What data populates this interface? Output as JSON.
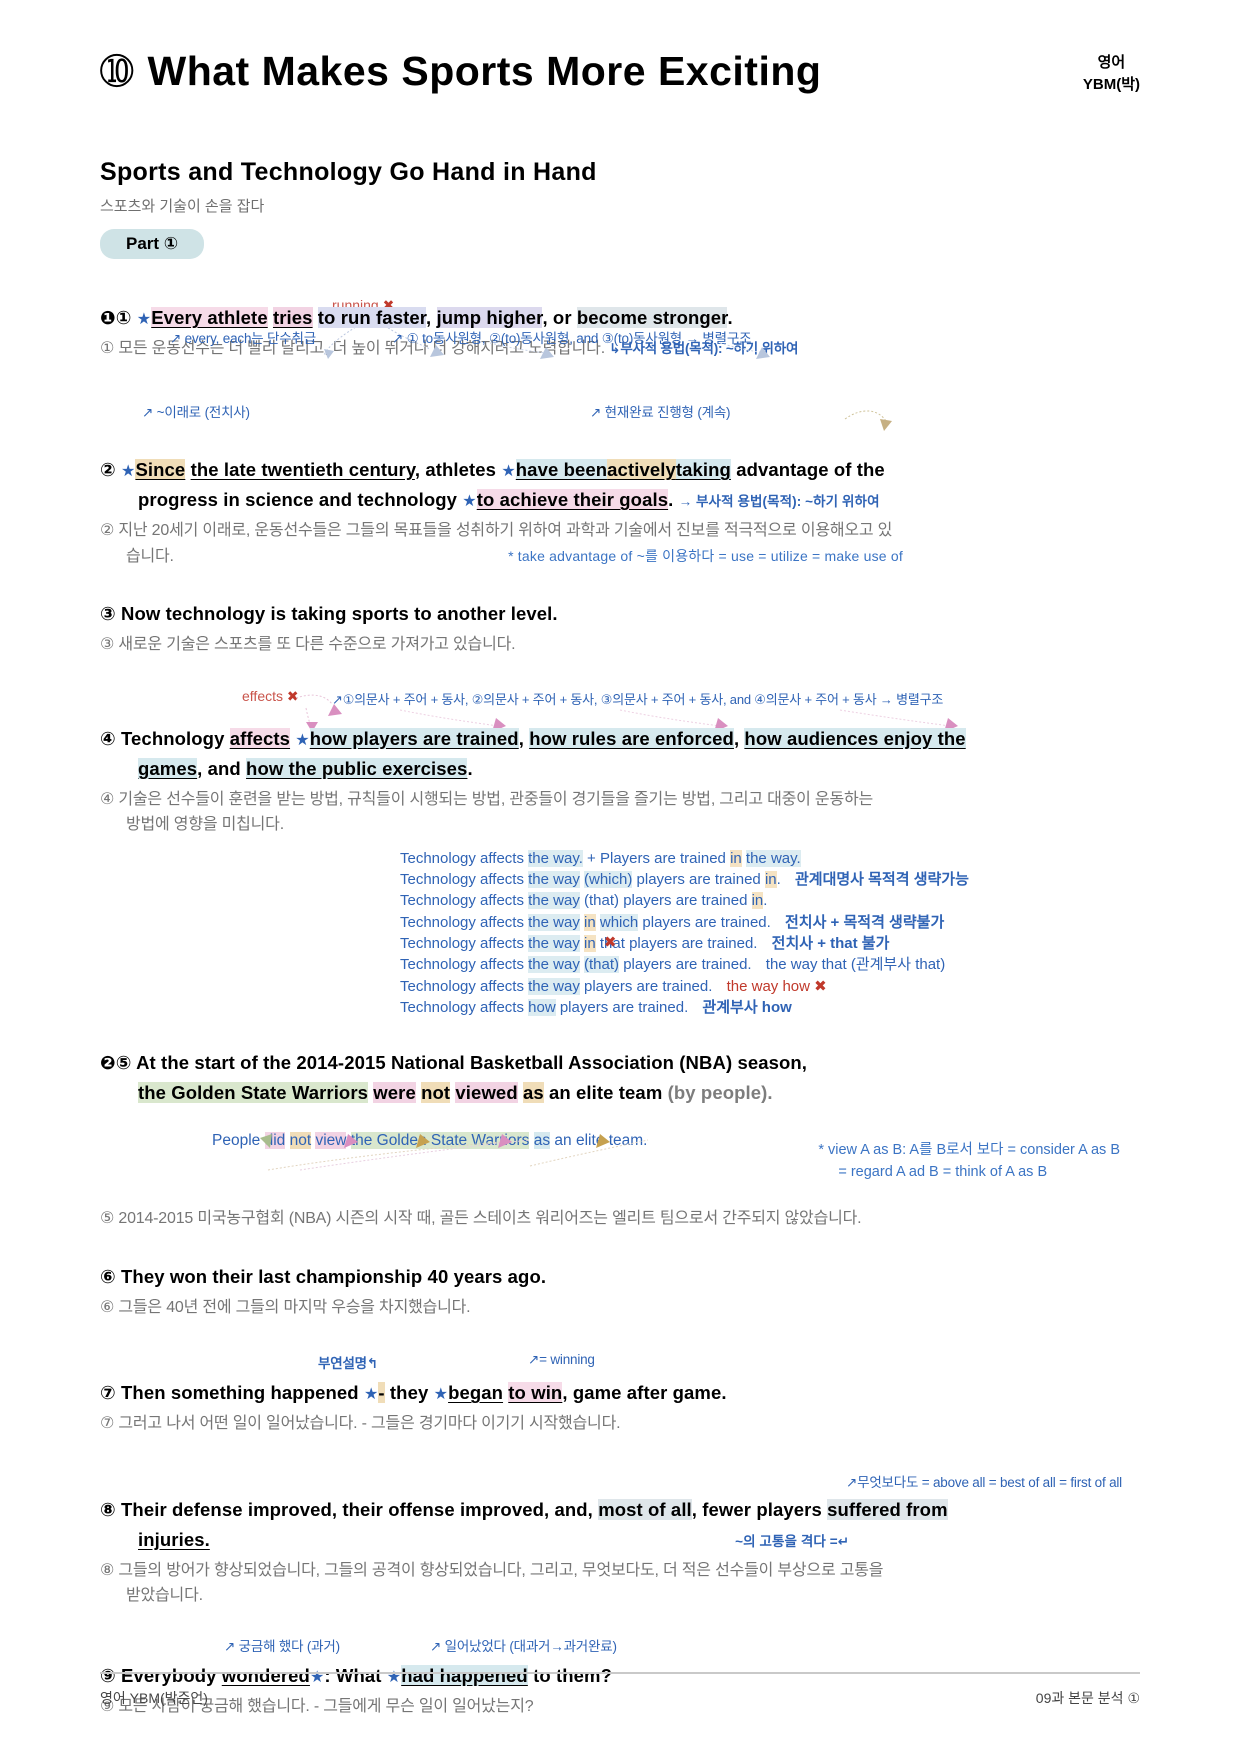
{
  "header": {
    "lesson_number": "➉",
    "title": "What Makes Sports More Exciting",
    "subject": "영어",
    "publisher": "YBM(박)"
  },
  "section": {
    "title": "Sports and Technology Go Hand in Hand",
    "korean": "스포츠와 기술이 손을 잡다",
    "part_label": "Part ①"
  },
  "s1": {
    "ann_red": "running",
    "ann_left": "every, each는  단수취급",
    "ann_right": "① to동사원형, ②(to)동사원형, and  ③(to)동사원형 → 병렬구조",
    "num": "❶①",
    "e1": "Every athlete",
    "e2": "tries",
    "e3": "to run faster",
    "e4": "jump higher",
    "e5": "become stronger",
    "kor": "① 모든 운동선수는 더 빨리 달리고, 더 높이 뛰거나 더 강해지려고 노력합니다.",
    "kor_note": "부사적 용법(목적): ~하기 위하여"
  },
  "s2": {
    "ann_left": "~이래로 (전치사)",
    "ann_right": "현재완료 진행형 (계속)",
    "num": "②",
    "e1": "Since",
    "e2": "the late twentieth century",
    "e3": "athletes",
    "e4": "have been",
    "e5": "actively",
    "e6": "taking",
    "e7": "advantage of the",
    "e8": "progress in science and technology",
    "e9": "to achieve their goals",
    "note_line": "→ 부사적 용법(목적): ~하기 위하여",
    "kor1": "② 지난 20세기 이래로, 운동선수들은 그들의 목표들을 성취하기 위하여 과학과 기술에서 진보를 적극적으로 이용해오고 있",
    "kor2": "습니다.",
    "note_right": "* take advantage of ~를 이용하다 = use = utilize = make use of"
  },
  "s3": {
    "num": "③",
    "eng": "Now technology is taking sports to another level.",
    "kor": "③ 새로운 기술은 스포츠를 또 다른 수준으로 가져가고 있습니다."
  },
  "s4": {
    "ann_red": "effects",
    "ann_right": "①의문사 + 주어 + 동사,  ②의문사 + 주어 + 동사,  ③의문사 + 주어 + 동사,  and  ④의문사 + 주어 + 동사 → 병렬구조",
    "num": "④",
    "e1": "Technology",
    "e2": "affects",
    "e3": "how players are trained",
    "e4": "how rules are enforced",
    "e5": "how audiences enjoy the",
    "e6": "games",
    "e7": "how the public exercises",
    "kor1": "④ 기술은 선수들이 훈련을 받는 방법, 규칙들이 시행되는 방법, 관중들이 경기들을 즐기는 방법, 그리고 대중이 운동하는",
    "kor2": "방법에 영향을 미칩니다."
  },
  "grammar_rows": [
    {
      "pre": "Technology affects ",
      "a": "the way.",
      "mid": " + Players are trained ",
      "b": "in",
      "post": " ",
      "c": "the way.",
      "label": "",
      "label_type": ""
    },
    {
      "pre": "Technology affects ",
      "a": "the way",
      "mid": " ",
      "b2": "(which)",
      "post": " players are trained ",
      "b": "in",
      ".": "",
      "label": "관계대명사 목적격 생략가능",
      "label_type": "bold"
    },
    {
      "pre": "Technology affects ",
      "a": "the way",
      "mid": " (that) players are trained ",
      "b": "in",
      "label": "",
      "label_type": ""
    },
    {
      "pre": "Technology affects ",
      "a": "the way",
      "mid": " ",
      "b": "in",
      "post": " which players are trained.",
      "label": "전치사 + 목적격  생략불가",
      "label_type": "bold"
    },
    {
      "pre": "Technology affects ",
      "a": "the way",
      "mid": " ",
      "b": "in",
      "post": " that players are trained.",
      "label": "전치사 + that 불가",
      "label_type": "bold",
      "x": true
    },
    {
      "pre": "Technology affects ",
      "a": "the way",
      "mid": " (that) players are trained.",
      "label": "the way that (관계부사 that)",
      "label_type": "norm"
    },
    {
      "pre": "Technology affects ",
      "a": "the way",
      "mid": " players are trained.",
      "label": "the way how",
      "label_type": "red"
    },
    {
      "pre": "Technology affects ",
      "a": "how",
      "mid": " players are trained.",
      "label": "관계부사 how",
      "label_type": "bold"
    }
  ],
  "s5": {
    "num": "❷⑤",
    "e0": "At the start of the 2014-2015 National Basketball Association (NBA) season,",
    "e1": "the Golden State Warriors",
    "e2": "were",
    "e3": "not",
    "e4": "viewed",
    "e5": "as",
    "e6": "an elite team",
    "e7": "(by people).",
    "rewrite_pre": "People ",
    "rw1": "did",
    "rw2": "not",
    "rw3": "view",
    "rw4": "the Golden State Warriors",
    "rw5": "as",
    "rw6": " an elite team.",
    "note1": "* view A as B: A를 B로서 보다 = consider A as B",
    "note2": "= regard A ad B = think of A as B",
    "kor": "⑤ 2014-2015 미국농구협회 (NBA) 시즌의 시작 때, 골든 스테이츠 워리어즈는 엘리트 팀으로서 간주되지 않았습니다."
  },
  "s6": {
    "num": "⑥",
    "eng": "They won their last championship 40 years ago.",
    "kor": "⑥ 그들은 40년 전에 그들의 마지막 우승을 차지했습니다."
  },
  "s7": {
    "ann_left": "부연설명",
    "ann_right": "= winning",
    "num": "⑦",
    "e1": "Then something happened",
    "e2": "they",
    "e3": "began",
    "e4": "to win",
    "e5": ", game after game.",
    "kor": "⑦ 그러고 나서 어떤 일이 일어났습니다. - 그들은 경기마다 이기기 시작했습니다."
  },
  "s8": {
    "ann_right": "무엇보다도 = above all = best of all = first of all",
    "num": "⑧",
    "e1": "Their defense improved, their offense improved, and,",
    "e2": "most of all",
    "e3": ", fewer players",
    "e4": "suffered from",
    "e5": "injuries.",
    "note_right": "~의 고통을 격다 =",
    "kor1": "⑧ 그들의 방어가 향상되었습니다, 그들의 공격이 향상되었습니다, 그리고, 무엇보다도, 더 적은 선수들이 부상으로 고통을",
    "kor2": "받았습니다."
  },
  "s9": {
    "ann_left": "궁금해 했다 (과거)",
    "ann_right": "일어났었다 (대과거→과거완료)",
    "num": "⑨",
    "e1": "Everybody",
    "e2": "wondered",
    "e3": ": What",
    "e4": "had happened",
    "e5": "to them?",
    "kor": "⑨ 모든 사람이 궁금해 했습니다. - 그들에게 무슨 일이 일어났는지?"
  },
  "footer": {
    "left": "영어 YBM(박준언)",
    "right": "09과 본문 분석 ①"
  }
}
